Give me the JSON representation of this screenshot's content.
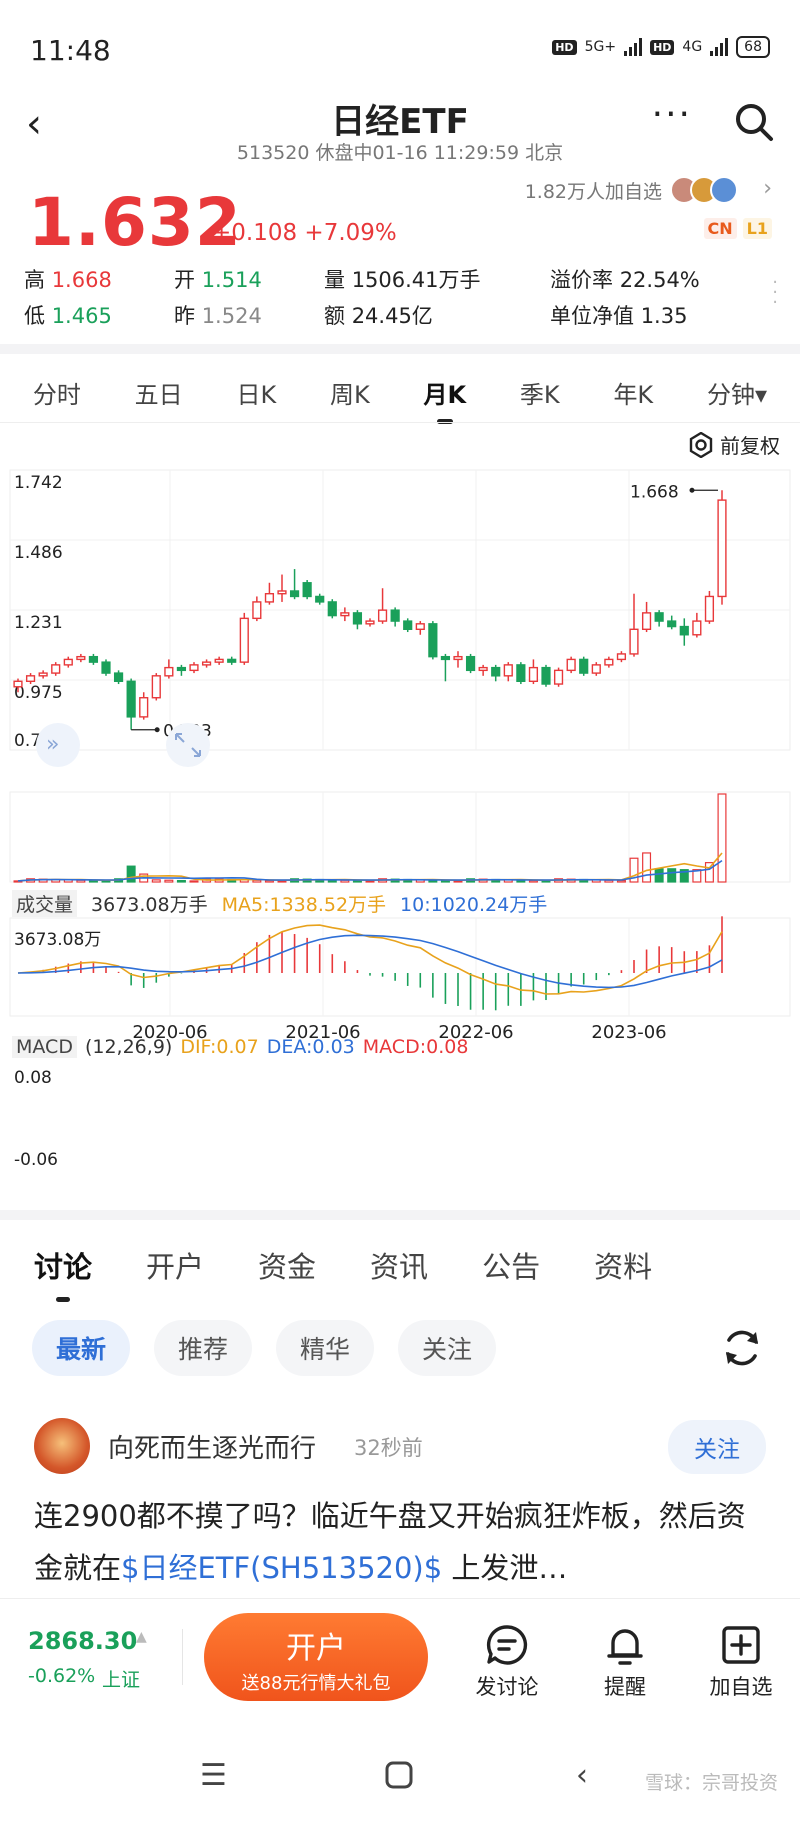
{
  "status": {
    "time": "11:48",
    "net1": "5G+",
    "net2": "4G",
    "hd": "HD",
    "battery": "68"
  },
  "header": {
    "title": "日经ETF",
    "subtitle": "513520 休盘中01-16 11:29:59 北京"
  },
  "quote": {
    "price": "1.632",
    "change": "+0.108 +7.09%",
    "watchers": "1.82万人加自选",
    "tag_cn": "CN",
    "tag_l1": "L1",
    "stats": [
      {
        "k": "高",
        "v": "1.668",
        "color": "red"
      },
      {
        "k": "开",
        "v": "1.514",
        "color": "green"
      },
      {
        "k": "量",
        "v": "1506.41万手",
        "color": "plain"
      },
      {
        "k": "溢价率",
        "v": "22.54%",
        "color": "plain"
      },
      {
        "k": "低",
        "v": "1.465",
        "color": "green"
      },
      {
        "k": "昨",
        "v": "1.524",
        "color": "gray"
      },
      {
        "k": "额",
        "v": "24.45亿",
        "color": "plain"
      },
      {
        "k": "单位净值",
        "v": "1.35",
        "color": "plain"
      }
    ]
  },
  "ktabs": [
    "分时",
    "五日",
    "日K",
    "周K",
    "月K",
    "季K",
    "年K",
    "分钟▾"
  ],
  "adjust": "前复权",
  "chart_data": {
    "type": "candlestick",
    "price_axis": [
      "1.742",
      "1.486",
      "1.231",
      "0.975",
      "0.719"
    ],
    "ylim": [
      0.719,
      1.742
    ],
    "high_label": "1.668",
    "low_label": "0.793",
    "x_ticks": [
      "2020-06",
      "2021-06",
      "2022-06",
      "2023-06"
    ],
    "candles": [
      [
        0.95,
        0.97,
        0.93,
        0.98
      ],
      [
        0.97,
        0.99,
        0.96,
        1.0
      ],
      [
        0.99,
        1.0,
        0.98,
        1.01
      ],
      [
        1.0,
        1.03,
        0.99,
        1.04
      ],
      [
        1.03,
        1.05,
        1.02,
        1.06
      ],
      [
        1.05,
        1.06,
        1.04,
        1.07
      ],
      [
        1.06,
        1.04,
        1.03,
        1.07
      ],
      [
        1.04,
        1.0,
        0.99,
        1.05
      ],
      [
        1.0,
        0.97,
        0.96,
        1.01
      ],
      [
        0.97,
        0.84,
        0.793,
        0.98
      ],
      [
        0.84,
        0.91,
        0.83,
        0.93
      ],
      [
        0.91,
        0.99,
        0.9,
        1.0
      ],
      [
        0.99,
        1.02,
        0.98,
        1.05
      ],
      [
        1.02,
        1.01,
        0.99,
        1.03
      ],
      [
        1.01,
        1.03,
        1.0,
        1.04
      ],
      [
        1.03,
        1.04,
        1.02,
        1.05
      ],
      [
        1.04,
        1.05,
        1.03,
        1.06
      ],
      [
        1.05,
        1.04,
        1.03,
        1.06
      ],
      [
        1.04,
        1.2,
        1.03,
        1.22
      ],
      [
        1.2,
        1.26,
        1.19,
        1.28
      ],
      [
        1.26,
        1.29,
        1.25,
        1.33
      ],
      [
        1.29,
        1.3,
        1.26,
        1.36
      ],
      [
        1.3,
        1.28,
        1.27,
        1.38
      ],
      [
        1.33,
        1.28,
        1.27,
        1.34
      ],
      [
        1.28,
        1.26,
        1.25,
        1.29
      ],
      [
        1.26,
        1.21,
        1.2,
        1.27
      ],
      [
        1.21,
        1.22,
        1.19,
        1.24
      ],
      [
        1.22,
        1.18,
        1.16,
        1.23
      ],
      [
        1.18,
        1.19,
        1.17,
        1.2
      ],
      [
        1.19,
        1.23,
        1.18,
        1.31
      ],
      [
        1.23,
        1.19,
        1.17,
        1.24
      ],
      [
        1.19,
        1.16,
        1.15,
        1.2
      ],
      [
        1.16,
        1.18,
        1.14,
        1.19
      ],
      [
        1.18,
        1.06,
        1.05,
        1.19
      ],
      [
        1.06,
        1.05,
        0.97,
        1.07
      ],
      [
        1.05,
        1.06,
        1.02,
        1.08
      ],
      [
        1.06,
        1.01,
        1.0,
        1.07
      ],
      [
        1.01,
        1.02,
        0.99,
        1.03
      ],
      [
        1.02,
        0.99,
        0.97,
        1.03
      ],
      [
        0.99,
        1.03,
        0.97,
        1.04
      ],
      [
        1.03,
        0.97,
        0.96,
        1.04
      ],
      [
        0.97,
        1.02,
        0.96,
        1.05
      ],
      [
        1.02,
        0.96,
        0.95,
        1.03
      ],
      [
        0.96,
        1.01,
        0.95,
        1.02
      ],
      [
        1.01,
        1.05,
        1.0,
        1.06
      ],
      [
        1.05,
        1.0,
        0.99,
        1.06
      ],
      [
        1.0,
        1.03,
        0.99,
        1.04
      ],
      [
        1.03,
        1.05,
        1.02,
        1.06
      ],
      [
        1.05,
        1.07,
        1.04,
        1.08
      ],
      [
        1.07,
        1.16,
        1.06,
        1.29
      ],
      [
        1.16,
        1.22,
        1.15,
        1.26
      ],
      [
        1.22,
        1.19,
        1.17,
        1.23
      ],
      [
        1.19,
        1.17,
        1.16,
        1.21
      ],
      [
        1.17,
        1.14,
        1.1,
        1.2
      ],
      [
        1.14,
        1.19,
        1.13,
        1.22
      ],
      [
        1.19,
        1.28,
        1.18,
        1.3
      ],
      [
        1.28,
        1.632,
        1.25,
        1.668
      ]
    ],
    "volume": {
      "label": "成交量",
      "current": "3673.08万手",
      "ma5": "MA5:1338.52万手",
      "ma10": "10:1020.24万手",
      "axis_max": "3673.08万"
    },
    "macd": {
      "label": "MACD",
      "params": "(12,26,9)",
      "dif": "DIF:0.07",
      "dea": "DEA:0.03",
      "macd": "MACD:0.08",
      "axis_top": "0.08",
      "axis_bottom": "-0.06"
    }
  },
  "detail_tabs": [
    "讨论",
    "开户",
    "资金",
    "资讯",
    "公告",
    "资料"
  ],
  "filters": [
    "最新",
    "推荐",
    "精华",
    "关注"
  ],
  "post": {
    "user": "向死而生逐光而行",
    "time": "32秒前",
    "follow": "关注",
    "text_before": "连2900都不摸了吗？临近午盘又开始疯狂炸板，然后资金就在",
    "link": "$日经ETF(SH513520)$",
    "text_after": " 上发泄…"
  },
  "actionbar": {
    "index_value": "2868.30",
    "index_change": "-0.62%",
    "index_name": "上证",
    "open_title": "开户",
    "open_sub": "送88元行情大礼包",
    "discuss": "发讨论",
    "remind": "提醒",
    "add_watch": "加自选"
  },
  "watermark": "雪球：宗哥投资"
}
